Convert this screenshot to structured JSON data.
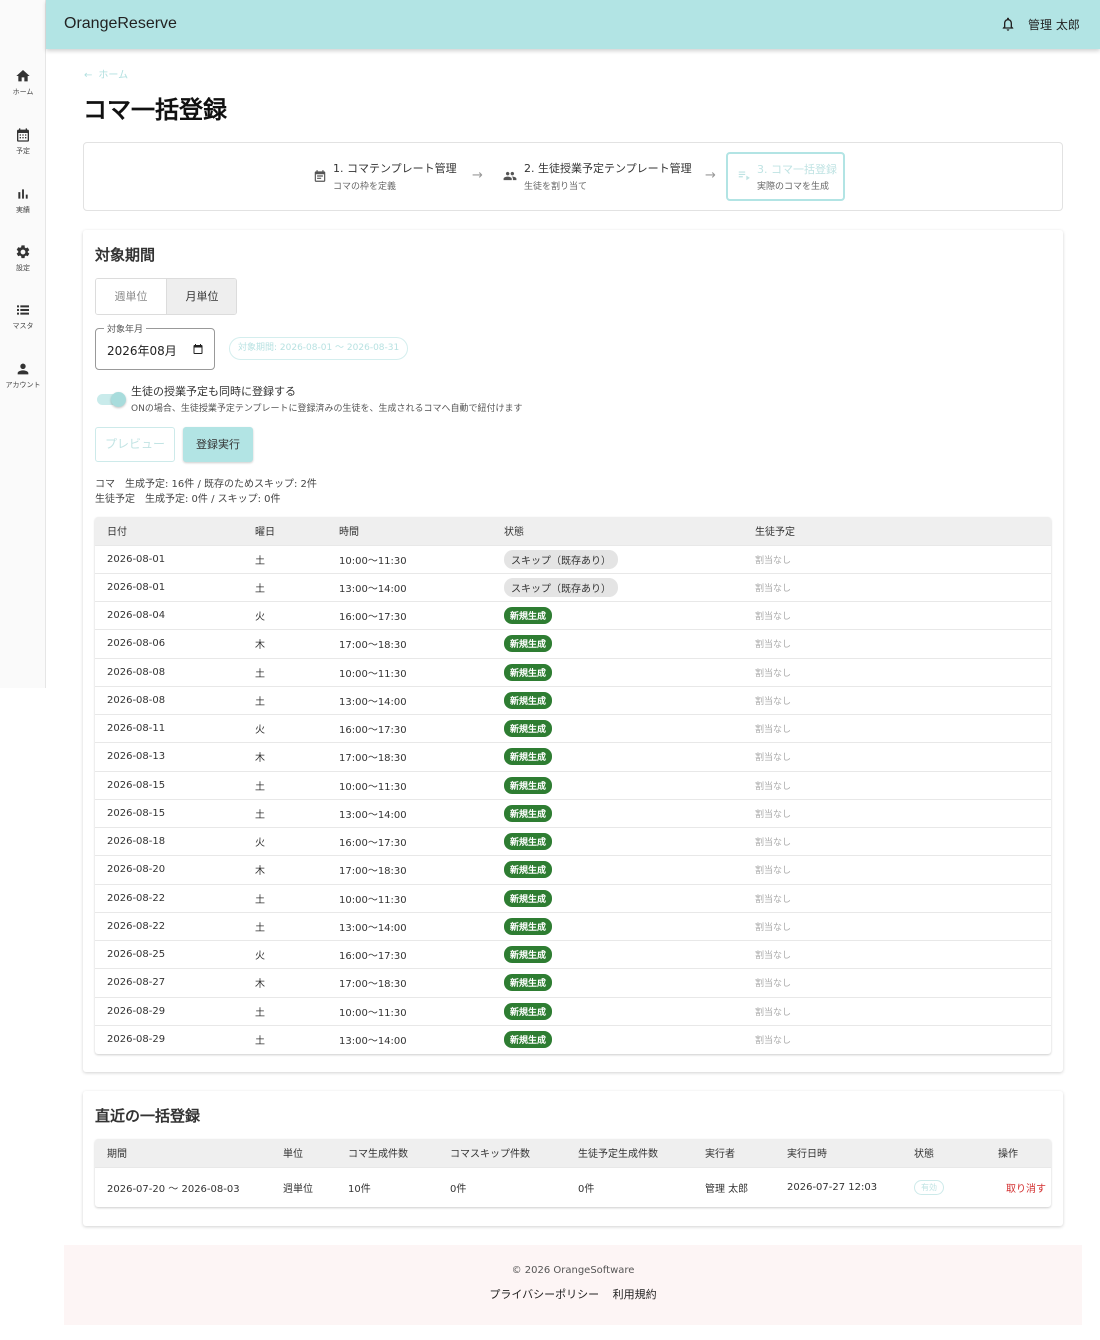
{
  "app": {
    "brand": "OrangeReserve",
    "user_name": "管理 太郎"
  },
  "sidebar": {
    "items": [
      {
        "label": "ホーム",
        "icon": "home-icon"
      },
      {
        "label": "予定",
        "icon": "calendar-icon"
      },
      {
        "label": "実績",
        "icon": "bar-chart-icon"
      },
      {
        "label": "設定",
        "icon": "gear-icon"
      },
      {
        "label": "マスタ",
        "icon": "list-icon"
      },
      {
        "label": "アカウント",
        "icon": "person-icon"
      }
    ]
  },
  "page": {
    "back_label": "ホーム",
    "title": "コマ一括登録"
  },
  "stepper": {
    "steps": [
      {
        "title": "1. コマテンプレート管理",
        "subtitle": "コマの枠を定義",
        "icon": "calendar-icon"
      },
      {
        "title": "2. 生徒授業予定テンプレート管理",
        "subtitle": "生徒を割り当て",
        "icon": "people-icon"
      },
      {
        "title": "3. コマ一括登録",
        "subtitle": "実際のコマを生成",
        "icon": "playlist-icon"
      }
    ]
  },
  "period": {
    "title": "対象期間",
    "unit_week": "週単位",
    "unit_month": "月単位",
    "selected_unit": "月単位",
    "field_label": "対象年月",
    "field_value": "2026年08月",
    "range_chip": "対象期間: 2026-08-01 〜 2026-08-31",
    "switch_label": "生徒の授業予定も同時に登録する",
    "switch_on": true,
    "switch_help": "ONの場合、生徒授業予定テンプレートに登録済みの生徒を、生成されるコマへ自動で紐付けます",
    "preview_button": "プレビュー",
    "execute_button": "登録実行",
    "summary_koma": "コマ　生成予定: 16件 / 既存のためスキップ: 2件",
    "summary_student": "生徒予定　生成予定: 0件 / スキップ: 0件"
  },
  "preview_table": {
    "headers": [
      "日付",
      "曜日",
      "時間",
      "状態",
      "生徒予定"
    ],
    "rows": [
      {
        "date": "2026-08-01",
        "weekday": "土",
        "time": "10:00〜11:30",
        "status": "スキップ（既存あり）",
        "status_type": "skip",
        "student": "割当なし"
      },
      {
        "date": "2026-08-01",
        "weekday": "土",
        "time": "13:00〜14:00",
        "status": "スキップ（既存あり）",
        "status_type": "skip",
        "student": "割当なし"
      },
      {
        "date": "2026-08-04",
        "weekday": "火",
        "time": "16:00〜17:30",
        "status": "新規生成",
        "status_type": "new",
        "student": "割当なし"
      },
      {
        "date": "2026-08-06",
        "weekday": "木",
        "time": "17:00〜18:30",
        "status": "新規生成",
        "status_type": "new",
        "student": "割当なし"
      },
      {
        "date": "2026-08-08",
        "weekday": "土",
        "time": "10:00〜11:30",
        "status": "新規生成",
        "status_type": "new",
        "student": "割当なし"
      },
      {
        "date": "2026-08-08",
        "weekday": "土",
        "time": "13:00〜14:00",
        "status": "新規生成",
        "status_type": "new",
        "student": "割当なし"
      },
      {
        "date": "2026-08-11",
        "weekday": "火",
        "time": "16:00〜17:30",
        "status": "新規生成",
        "status_type": "new",
        "student": "割当なし"
      },
      {
        "date": "2026-08-13",
        "weekday": "木",
        "time": "17:00〜18:30",
        "status": "新規生成",
        "status_type": "new",
        "student": "割当なし"
      },
      {
        "date": "2026-08-15",
        "weekday": "土",
        "time": "10:00〜11:30",
        "status": "新規生成",
        "status_type": "new",
        "student": "割当なし"
      },
      {
        "date": "2026-08-15",
        "weekday": "土",
        "time": "13:00〜14:00",
        "status": "新規生成",
        "status_type": "new",
        "student": "割当なし"
      },
      {
        "date": "2026-08-18",
        "weekday": "火",
        "time": "16:00〜17:30",
        "status": "新規生成",
        "status_type": "new",
        "student": "割当なし"
      },
      {
        "date": "2026-08-20",
        "weekday": "木",
        "time": "17:00〜18:30",
        "status": "新規生成",
        "status_type": "new",
        "student": "割当なし"
      },
      {
        "date": "2026-08-22",
        "weekday": "土",
        "time": "10:00〜11:30",
        "status": "新規生成",
        "status_type": "new",
        "student": "割当なし"
      },
      {
        "date": "2026-08-22",
        "weekday": "土",
        "time": "13:00〜14:00",
        "status": "新規生成",
        "status_type": "new",
        "student": "割当なし"
      },
      {
        "date": "2026-08-25",
        "weekday": "火",
        "time": "16:00〜17:30",
        "status": "新規生成",
        "status_type": "new",
        "student": "割当なし"
      },
      {
        "date": "2026-08-27",
        "weekday": "木",
        "time": "17:00〜18:30",
        "status": "新規生成",
        "status_type": "new",
        "student": "割当なし"
      },
      {
        "date": "2026-08-29",
        "weekday": "土",
        "time": "10:00〜11:30",
        "status": "新規生成",
        "status_type": "new",
        "student": "割当なし"
      },
      {
        "date": "2026-08-29",
        "weekday": "土",
        "time": "13:00〜14:00",
        "status": "新規生成",
        "status_type": "new",
        "student": "割当なし"
      }
    ]
  },
  "recent": {
    "title": "直近の一括登録",
    "headers": [
      "期間",
      "単位",
      "コマ生成件数",
      "コマスキップ件数",
      "生徒予定生成件数",
      "実行者",
      "実行日時",
      "状態",
      "操作"
    ],
    "rows": [
      {
        "period": "2026-07-20 〜 2026-08-03",
        "unit": "週単位",
        "koma_created": "10件",
        "koma_skipped": "0件",
        "student_created": "0件",
        "executor": "管理 太郎",
        "executed_at": "2026-07-27 12:03",
        "status": "有効",
        "action": "取り消す"
      }
    ]
  },
  "footer": {
    "copyright": "© 2026 OrangeSoftware",
    "privacy": "プライバシーポリシー",
    "terms": "利用規約"
  },
  "colors": {
    "appbar": "#b2e4e4",
    "accent": "#b2e4e4",
    "new_chip": "#2e7d32",
    "cancel": "#d32f2f"
  }
}
